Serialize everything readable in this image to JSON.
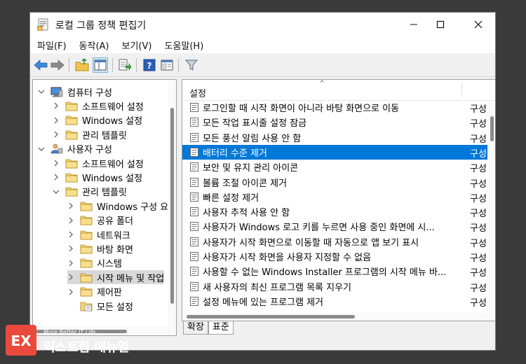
{
  "window": {
    "title": "로컬 그룹 정책 편집기"
  },
  "menu": [
    "파일(F)",
    "동작(A)",
    "보기(V)",
    "도움말(H)"
  ],
  "tree": [
    {
      "label": "컴퓨터 구성",
      "level": 0,
      "expanded": true,
      "icon": "computer-icon"
    },
    {
      "label": "소프트웨어 설정",
      "level": 1,
      "expanded": false,
      "icon": "folder-icon"
    },
    {
      "label": "Windows 설정",
      "level": 1,
      "expanded": false,
      "icon": "folder-icon"
    },
    {
      "label": "관리 템플릿",
      "level": 1,
      "expanded": false,
      "icon": "folder-icon"
    },
    {
      "label": "사용자 구성",
      "level": 0,
      "expanded": true,
      "icon": "user-icon"
    },
    {
      "label": "소프트웨어 설정",
      "level": 1,
      "expanded": false,
      "icon": "folder-icon"
    },
    {
      "label": "Windows 설정",
      "level": 1,
      "expanded": false,
      "icon": "folder-icon"
    },
    {
      "label": "관리 템플릿",
      "level": 1,
      "expanded": true,
      "icon": "folder-icon"
    },
    {
      "label": "Windows 구성 요",
      "level": 2,
      "expanded": false,
      "icon": "folder-icon"
    },
    {
      "label": "공유 폴더",
      "level": 2,
      "expanded": false,
      "icon": "folder-icon"
    },
    {
      "label": "네트워크",
      "level": 2,
      "expanded": false,
      "icon": "folder-icon"
    },
    {
      "label": "바탕 화면",
      "level": 2,
      "expanded": false,
      "icon": "folder-icon"
    },
    {
      "label": "시스템",
      "level": 2,
      "expanded": false,
      "icon": "folder-icon"
    },
    {
      "label": "시작 메뉴 및 작업",
      "level": 2,
      "expanded": false,
      "icon": "folder-icon",
      "selected": true
    },
    {
      "label": "제어판",
      "level": 2,
      "expanded": false,
      "icon": "folder-icon"
    },
    {
      "label": "모든 설정",
      "level": 2,
      "expanded": null,
      "icon": "settings-folder-icon"
    }
  ],
  "list": {
    "column_setting": "설정",
    "rows": [
      {
        "label": "로그인할 때 시작 화면이 아니라 바탕 화면으로 이동",
        "state": "구성"
      },
      {
        "label": "모든 작업 표시줄 설정 잠금",
        "state": "구성"
      },
      {
        "label": "모든 풍선 알림 사용 안 함",
        "state": "구성"
      },
      {
        "label": "배터리 수준 제거",
        "state": "구성",
        "selected": true
      },
      {
        "label": "보안 및 유지 관리 아이콘",
        "state": "구성"
      },
      {
        "label": "볼륨 조절 아이콘 제거",
        "state": "구성"
      },
      {
        "label": "빠른 설정 제거",
        "state": "구성"
      },
      {
        "label": "사용자 추적 사용 안 함",
        "state": "구성"
      },
      {
        "label": "사용자가 Windows 로고 키를 누르면 사용 중인 화면에 시...",
        "state": "구성"
      },
      {
        "label": "사용자가 시작 화면으로 이동할 때 자동으로 앱 보기 표시",
        "state": "구성"
      },
      {
        "label": "사용자가 시작 화면을 사용자 지정할 수 없음",
        "state": "구성"
      },
      {
        "label": "사용할 수 없는 Windows Installer 프로그램의 시작 메뉴 바...",
        "state": "구성"
      },
      {
        "label": "새 사용자의 최신 프로그램 목록 지우기",
        "state": "구성"
      },
      {
        "label": "설정 메뉴에 있는 프로그램 제거",
        "state": "구성"
      }
    ]
  },
  "tabs": [
    "확장",
    "표준"
  ],
  "watermark": {
    "tagline": "More Better IT Life",
    "name": "익스트림 매뉴얼",
    "mark": "EX"
  },
  "colors": {
    "selection": "#0078d7",
    "logo": "#e94a3c"
  }
}
